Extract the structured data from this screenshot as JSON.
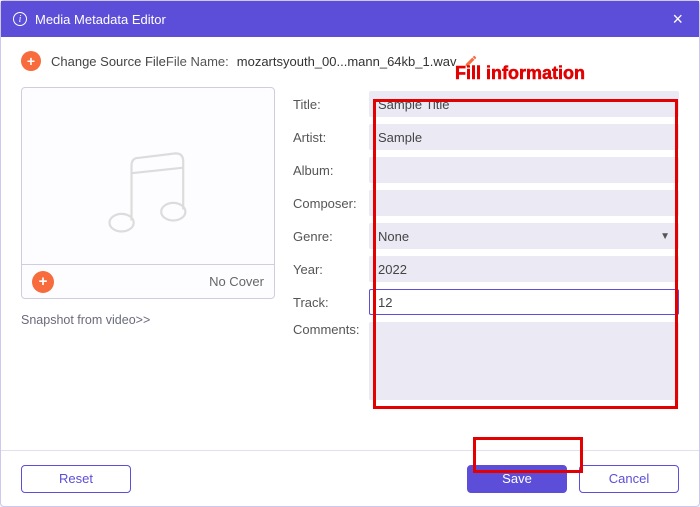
{
  "window": {
    "title": "Media Metadata Editor"
  },
  "toprow": {
    "change_source": "Change Source File",
    "filename_label": "File Name:",
    "filename_value": "mozartsyouth_00...mann_64kb_1.wav"
  },
  "annotation": {
    "fill_info": "Fill information"
  },
  "cover": {
    "no_cover": "No Cover",
    "snapshot_link": "Snapshot from video>>"
  },
  "form": {
    "labels": {
      "title": "Title:",
      "artist": "Artist:",
      "album": "Album:",
      "composer": "Composer:",
      "genre": "Genre:",
      "year": "Year:",
      "track": "Track:",
      "comments": "Comments:"
    },
    "values": {
      "title": "Sample Title",
      "artist": "Sample",
      "album": "",
      "composer": "",
      "genre": "None",
      "year": "2022",
      "track": "12",
      "comments": ""
    }
  },
  "footer": {
    "reset": "Reset",
    "save": "Save",
    "cancel": "Cancel"
  }
}
